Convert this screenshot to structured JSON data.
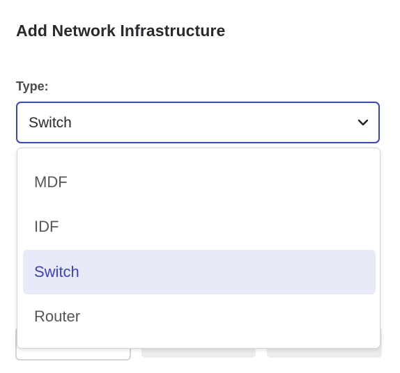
{
  "dialog": {
    "title": "Add Network Infrastructure"
  },
  "type_field": {
    "label": "Type:",
    "selected_value": "Switch",
    "options": [
      {
        "label": "MDF",
        "selected": false
      },
      {
        "label": "IDF",
        "selected": false
      },
      {
        "label": "Switch",
        "selected": true
      },
      {
        "label": "Router",
        "selected": false
      }
    ]
  },
  "colors": {
    "accent": "#3743c8",
    "selected_bg": "#e8eaf8",
    "selected_text": "#3a44c6",
    "text": "#2a2a2e"
  },
  "icons": {
    "select_chevron": "chevron-down-icon"
  }
}
